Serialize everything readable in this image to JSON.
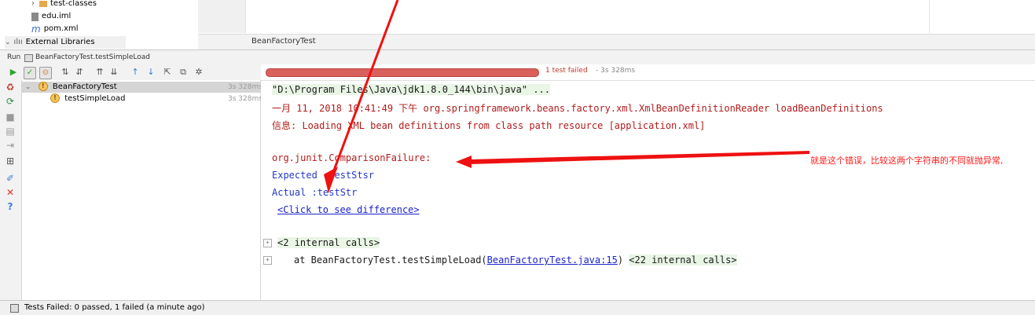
{
  "project_tree": {
    "items": [
      {
        "label": "test-classes",
        "icon": "folder-icon"
      },
      {
        "label": "edu.iml",
        "icon": "iml-file-icon"
      },
      {
        "label": "pom.xml",
        "icon": "maven-icon"
      },
      {
        "label": "External Libraries",
        "icon": "library-icon"
      }
    ]
  },
  "editor": {
    "tab_label": "BeanFactoryTest"
  },
  "run_bar": {
    "label": "Run",
    "config": "BeanFactoryTest.testSimpleLoad"
  },
  "test_status": {
    "text": "1 test failed",
    "time": "- 3s 328ms",
    "progress_fraction": 1.0,
    "color": "#d9605d"
  },
  "test_tree": {
    "root": {
      "label": "BeanFactoryTest",
      "time": "3s 328ms"
    },
    "children": [
      {
        "label": "testSimpleLoad",
        "time": "3s 328ms"
      }
    ]
  },
  "console": {
    "lines": [
      "\"D:\\Program Files\\Java\\jdk1.8.0_144\\bin\\java\" ...",
      "一月 11, 2018 10:41:49 下午 org.springframework.beans.factory.xml.XmlBeanDefinitionReader loadBeanDefinitions",
      "信息: Loading XML bean definitions from class path resource [application.xml]",
      "org.junit.ComparisonFailure:",
      "Expected :testStsr",
      "Actual   :testStr",
      "<Click to see difference>",
      "<2 internal calls>",
      "at BeanFactoryTest.testSimpleLoad(",
      "BeanFactoryTest.java:15",
      ")",
      "<22 internal calls>"
    ]
  },
  "annotation": {
    "text": "就是这个错误，比较这两个字符串的不同就抛异常,",
    "color": "#ff1a1a"
  },
  "status_bar": {
    "text": "Tests Failed: 0 passed, 1 failed (a minute ago)"
  }
}
